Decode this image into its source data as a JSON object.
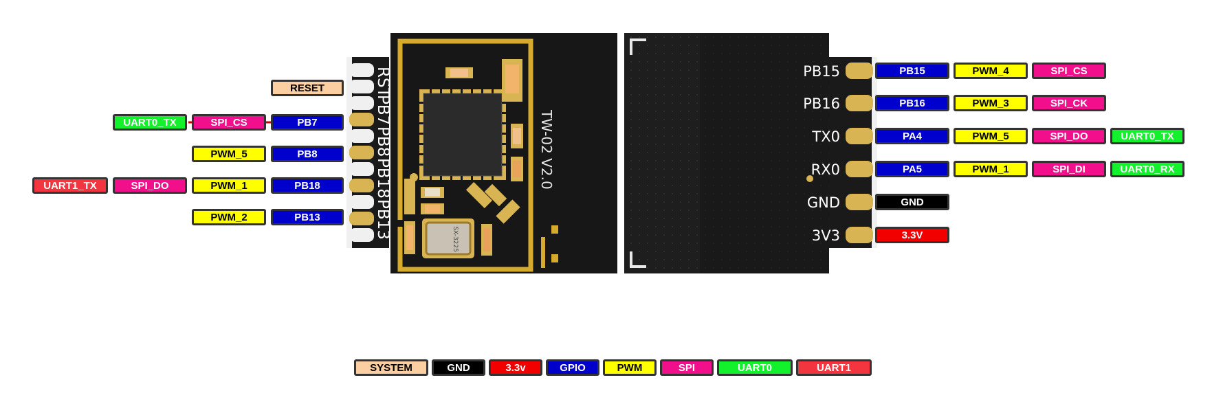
{
  "colors": {
    "SYSTEM": "#fccfa2",
    "GND": "#000000",
    "POWER": "#f20000",
    "GPIO": "#0000cd",
    "PWM": "#ffff00",
    "SPI": "#f20f8c",
    "UART0": "#12f12b",
    "UART1": "#f2353e",
    "board": "#1b1b1b",
    "pad": "#d8b453",
    "antenna": "#d6aa2c",
    "wire": "#cc0000"
  },
  "module": {
    "silkscreen": "TW-02  V2.0",
    "crystal_marking": "SX-3225"
  },
  "left_pins": [
    {
      "name": "RST",
      "labels": [
        {
          "text": "RESET",
          "type": "SYSTEM"
        }
      ]
    },
    {
      "name": "PB7",
      "labels": [
        {
          "text": "PB7",
          "type": "GPIO"
        },
        {
          "text": "SPI_CS",
          "type": "SPI"
        },
        {
          "text": "UART0_TX",
          "type": "UART0"
        }
      ]
    },
    {
      "name": "PB8",
      "labels": [
        {
          "text": "PB8",
          "type": "GPIO"
        },
        {
          "text": "PWM_5",
          "type": "PWM"
        }
      ]
    },
    {
      "name": "PB18",
      "labels": [
        {
          "text": "PB18",
          "type": "GPIO"
        },
        {
          "text": "PWM_1",
          "type": "PWM"
        },
        {
          "text": "SPI_DO",
          "type": "SPI"
        },
        {
          "text": "UART1_TX",
          "type": "UART1"
        }
      ]
    },
    {
      "name": "PB13",
      "labels": [
        {
          "text": "PB13",
          "type": "GPIO"
        },
        {
          "text": "PWM_2",
          "type": "PWM"
        }
      ]
    }
  ],
  "right_pins": [
    {
      "name": "PB15",
      "labels": [
        {
          "text": "PB15",
          "type": "GPIO"
        },
        {
          "text": "PWM_4",
          "type": "PWM"
        },
        {
          "text": "SPI_CS",
          "type": "SPI"
        }
      ]
    },
    {
      "name": "PB16",
      "labels": [
        {
          "text": "PB16",
          "type": "GPIO"
        },
        {
          "text": "PWM_3",
          "type": "PWM"
        },
        {
          "text": "SPI_CK",
          "type": "SPI"
        }
      ]
    },
    {
      "name": "TX0",
      "labels": [
        {
          "text": "PA4",
          "type": "GPIO"
        },
        {
          "text": "PWM_5",
          "type": "PWM"
        },
        {
          "text": "SPI_DO",
          "type": "SPI"
        },
        {
          "text": "UART0_TX",
          "type": "UART0"
        }
      ]
    },
    {
      "name": "RX0",
      "labels": [
        {
          "text": "PA5",
          "type": "GPIO"
        },
        {
          "text": "PWM_1",
          "type": "PWM"
        },
        {
          "text": "SPI_DI",
          "type": "SPI"
        },
        {
          "text": "UART0_RX",
          "type": "UART0"
        }
      ]
    },
    {
      "name": "GND",
      "labels": [
        {
          "text": "GND",
          "type": "GND"
        }
      ]
    },
    {
      "name": "3V3",
      "labels": [
        {
          "text": "3.3V",
          "type": "POWER"
        }
      ]
    }
  ],
  "legend": [
    {
      "text": "SYSTEM",
      "type": "SYSTEM"
    },
    {
      "text": "GND",
      "type": "GND"
    },
    {
      "text": "3.3v",
      "type": "POWER"
    },
    {
      "text": "GPIO",
      "type": "GPIO"
    },
    {
      "text": "PWM",
      "type": "PWM"
    },
    {
      "text": "SPI",
      "type": "SPI"
    },
    {
      "text": "UART0",
      "type": "UART0"
    },
    {
      "text": "UART1",
      "type": "UART1"
    }
  ]
}
